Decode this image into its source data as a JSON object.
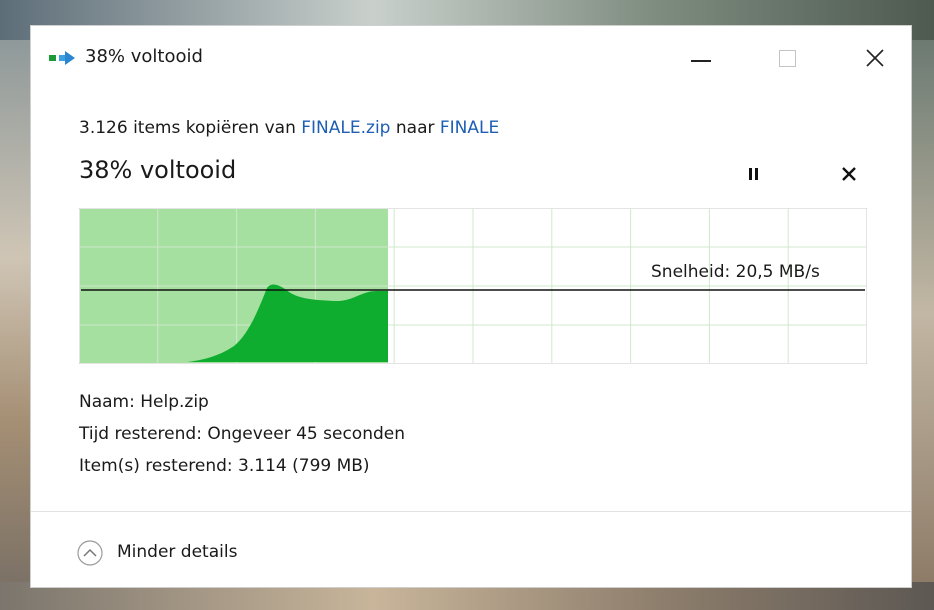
{
  "window": {
    "title": "38% voltooid",
    "controls": {
      "minimize_icon": "minimize-icon",
      "maximize_icon": "maximize-icon",
      "close_icon": "close-icon"
    }
  },
  "copy": {
    "count_text": "3.126 items kopiëren van ",
    "source": "FINALE.zip",
    "middle_text": " naar ",
    "destination": "FINALE"
  },
  "progress": {
    "label": "38% voltooid",
    "fraction": 0.38,
    "speed_label": "Snelheid: 20,5 MB/s"
  },
  "details": {
    "name": "Naam:  Help.zip",
    "time_remaining": "Tijd resterend:  Ongeveer 45 seconden",
    "items_remaining": "Item(s) resterend:  3.114 (799 MB)"
  },
  "footer": {
    "toggle_label": "Minder details",
    "toggle_icon": "chevron-up-circle-icon"
  },
  "colors": {
    "progress_fill": "#a6e0a0",
    "speed_area": "#0fad2f",
    "grid_line": "#cfe8cc",
    "link": "#1e5fb4"
  }
}
